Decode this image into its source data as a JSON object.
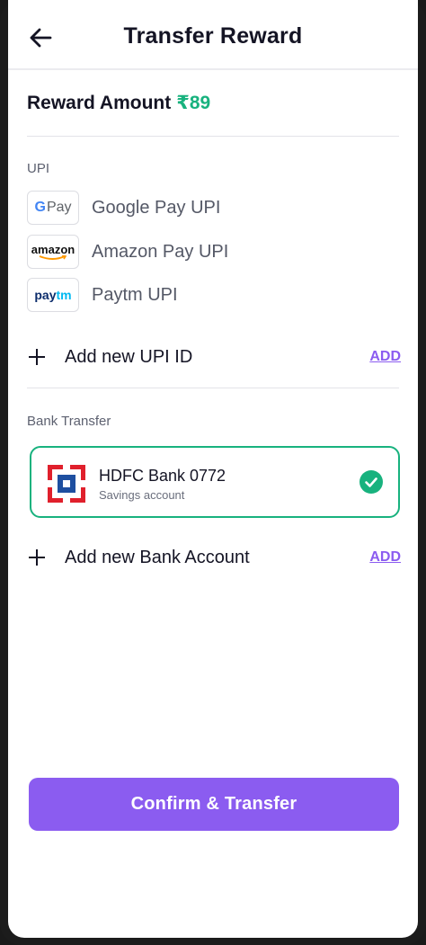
{
  "header": {
    "title": "Transfer Reward",
    "back_icon": "arrow-left-icon"
  },
  "reward": {
    "label": "Reward Amount",
    "amount": "₹89",
    "amount_color": "#18b27e"
  },
  "upi": {
    "section_label": "UPI",
    "items": [
      {
        "label": "Google Pay UPI",
        "logo_text_g": "G",
        "logo_text": "Pay",
        "icon": "google-pay-logo"
      },
      {
        "label": "Amazon Pay UPI",
        "logo_text": "amazon",
        "icon": "amazon-logo"
      },
      {
        "label": "Paytm UPI",
        "logo_text_a": "pay",
        "logo_text_b": "tm",
        "icon": "paytm-logo"
      }
    ],
    "add_label": "Add new UPI ID",
    "add_link": "ADD"
  },
  "bank": {
    "section_label": "Bank Transfer",
    "selected": {
      "name": "HDFC Bank 0772",
      "type": "Savings account",
      "icon": "hdfc-logo",
      "status_icon": "check-circle-icon"
    },
    "add_label": "Add new Bank Account",
    "add_link": "ADD"
  },
  "confirm_button": "Confirm & Transfer",
  "colors": {
    "accent": "#8b5cf0",
    "success": "#18b27e",
    "hdfc_red": "#e0202c",
    "hdfc_blue": "#1e4fa0"
  }
}
